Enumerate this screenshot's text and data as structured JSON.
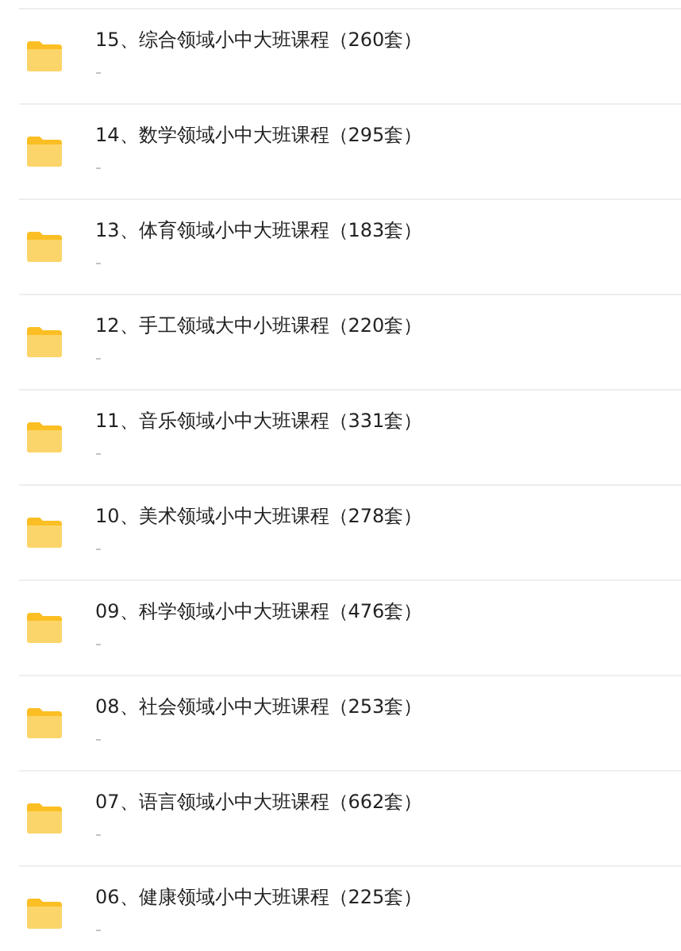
{
  "folders": [
    {
      "title": "15、综合领域小中大班课程（260套）",
      "subtitle": "-"
    },
    {
      "title": "14、数学领域小中大班课程（295套）",
      "subtitle": "-"
    },
    {
      "title": "13、体育领域小中大班课程（183套）",
      "subtitle": "-"
    },
    {
      "title": "12、手工领域大中小班课程（220套）",
      "subtitle": "-"
    },
    {
      "title": "11、音乐领域小中大班课程（331套）",
      "subtitle": "-"
    },
    {
      "title": "10、美术领域小中大班课程（278套）",
      "subtitle": "-"
    },
    {
      "title": "09、科学领域小中大班课程（476套）",
      "subtitle": "-"
    },
    {
      "title": "08、社会领域小中大班课程（253套）",
      "subtitle": "-"
    },
    {
      "title": "07、语言领域小中大班课程（662套）",
      "subtitle": "-"
    },
    {
      "title": "06、健康领域小中大班课程（225套）",
      "subtitle": "-"
    }
  ]
}
